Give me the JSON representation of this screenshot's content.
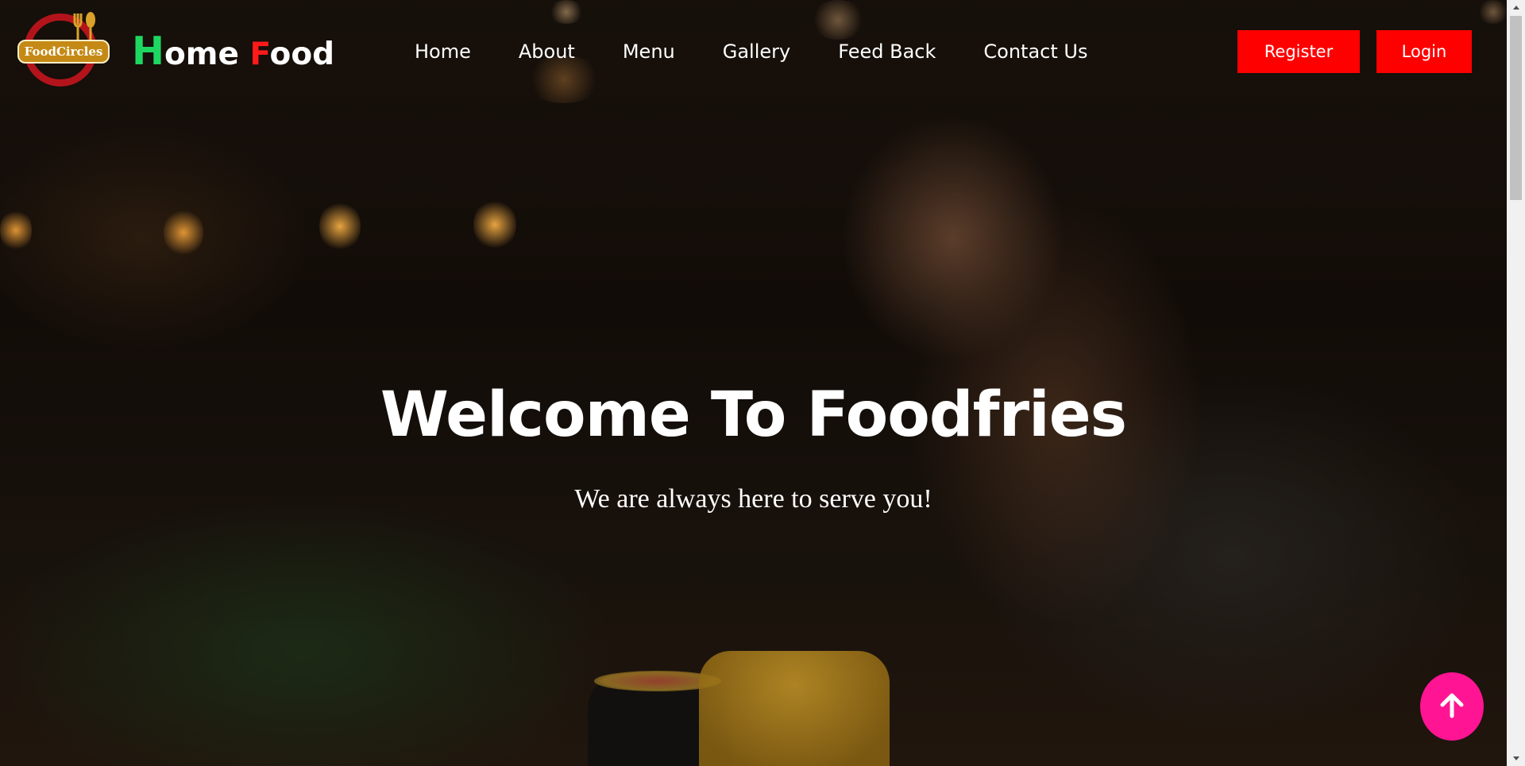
{
  "logo": {
    "text": "FoodCircles",
    "icon": "fork-spoon-icon"
  },
  "brand": {
    "first_letter": "H",
    "first_rest": "ome ",
    "second_letter": "F",
    "second_rest": "ood"
  },
  "nav": {
    "items": [
      {
        "label": "Home"
      },
      {
        "label": "About"
      },
      {
        "label": "Menu"
      },
      {
        "label": "Gallery"
      },
      {
        "label": "Feed Back"
      },
      {
        "label": "Contact Us"
      }
    ]
  },
  "auth": {
    "register_label": "Register",
    "login_label": "Login"
  },
  "hero": {
    "title": "Welcome To Foodfries",
    "subtitle": "We are always here to serve you!"
  },
  "scroll_top": {
    "icon": "arrow-up-icon"
  },
  "colors": {
    "accent_button": "#ff0000",
    "brand_h": "#1ed760",
    "brand_f": "#ff1a1a",
    "scroll_top": "#ff1493"
  }
}
